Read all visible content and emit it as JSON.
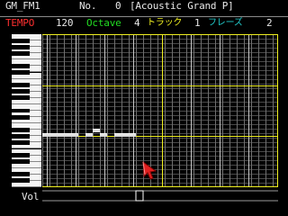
{
  "song": {
    "title": "GM_FM1"
  },
  "instrument": {
    "no_label": "No.",
    "number": "0",
    "name": "[Acoustic Grand P]"
  },
  "status": {
    "tempo_label": "TEMPO",
    "tempo_value": "120",
    "octave_label": "Octave",
    "octave_value": "4",
    "track_label": "トラック",
    "track_value": "1",
    "phrase_label": "フレーズ",
    "phrase_value": "2"
  },
  "velocity": {
    "label": "Vol"
  },
  "notes": [
    {
      "start_step": 0,
      "length_steps": 5,
      "pitch_row": 22
    },
    {
      "start_step": 6,
      "length_steps": 1,
      "pitch_row": 22
    },
    {
      "start_step": 7,
      "length_steps": 1,
      "pitch_row": 21
    },
    {
      "start_step": 8,
      "length_steps": 1,
      "pitch_row": 22
    },
    {
      "start_step": 10,
      "length_steps": 3,
      "pitch_row": 22
    }
  ],
  "colors": {
    "text": "#e8e8e8",
    "tempo": "#ff3030",
    "octave": "#22dd22",
    "phrase": "#22cccc",
    "measure_line": "#f0f020",
    "beat_line": "#c8c8c8",
    "note": "#dcdcdc",
    "cursor": "#e02020"
  }
}
